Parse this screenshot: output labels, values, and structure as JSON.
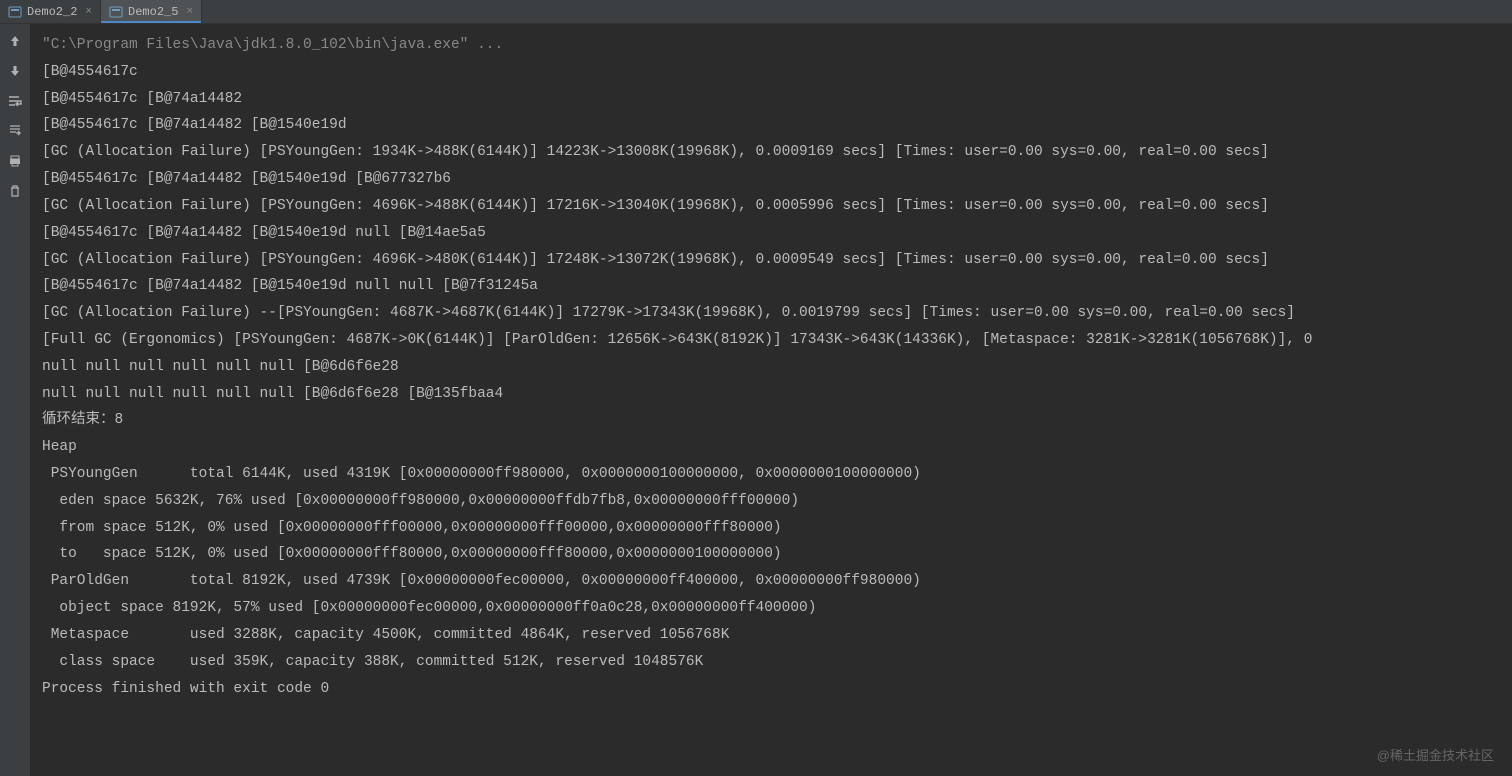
{
  "tabs": [
    {
      "label": "Demo2_2",
      "active": false
    },
    {
      "label": "Demo2_5",
      "active": true
    }
  ],
  "console": {
    "lines": [
      "\"C:\\Program Files\\Java\\jdk1.8.0_102\\bin\\java.exe\" ...",
      "[B@4554617c",
      "[B@4554617c [B@74a14482",
      "[B@4554617c [B@74a14482 [B@1540e19d",
      "[GC (Allocation Failure) [PSYoungGen: 1934K->488K(6144K)] 14223K->13008K(19968K), 0.0009169 secs] [Times: user=0.00 sys=0.00, real=0.00 secs]",
      "[B@4554617c [B@74a14482 [B@1540e19d [B@677327b6",
      "[GC (Allocation Failure) [PSYoungGen: 4696K->488K(6144K)] 17216K->13040K(19968K), 0.0005996 secs] [Times: user=0.00 sys=0.00, real=0.00 secs]",
      "[B@4554617c [B@74a14482 [B@1540e19d null [B@14ae5a5",
      "[GC (Allocation Failure) [PSYoungGen: 4696K->480K(6144K)] 17248K->13072K(19968K), 0.0009549 secs] [Times: user=0.00 sys=0.00, real=0.00 secs]",
      "[B@4554617c [B@74a14482 [B@1540e19d null null [B@7f31245a",
      "[GC (Allocation Failure) --[PSYoungGen: 4687K->4687K(6144K)] 17279K->17343K(19968K), 0.0019799 secs] [Times: user=0.00 sys=0.00, real=0.00 secs]",
      "[Full GC (Ergonomics) [PSYoungGen: 4687K->0K(6144K)] [ParOldGen: 12656K->643K(8192K)] 17343K->643K(14336K), [Metaspace: 3281K->3281K(1056768K)], 0",
      "null null null null null null [B@6d6f6e28",
      "null null null null null null [B@6d6f6e28 [B@135fbaa4",
      "循环结束：8",
      "Heap",
      " PSYoungGen      total 6144K, used 4319K [0x00000000ff980000, 0x0000000100000000, 0x0000000100000000)",
      "  eden space 5632K, 76% used [0x00000000ff980000,0x00000000ffdb7fb8,0x00000000fff00000)",
      "  from space 512K, 0% used [0x00000000fff00000,0x00000000fff00000,0x00000000fff80000)",
      "  to   space 512K, 0% used [0x00000000fff80000,0x00000000fff80000,0x0000000100000000)",
      " ParOldGen       total 8192K, used 4739K [0x00000000fec00000, 0x00000000ff400000, 0x00000000ff980000)",
      "  object space 8192K, 57% used [0x00000000fec00000,0x00000000ff0a0c28,0x00000000ff400000)",
      " Metaspace       used 3288K, capacity 4500K, committed 4864K, reserved 1056768K",
      "  class space    used 359K, capacity 388K, committed 512K, reserved 1048576K",
      "",
      "Process finished with exit code 0"
    ]
  },
  "watermark": "@稀土掘金技术社区"
}
